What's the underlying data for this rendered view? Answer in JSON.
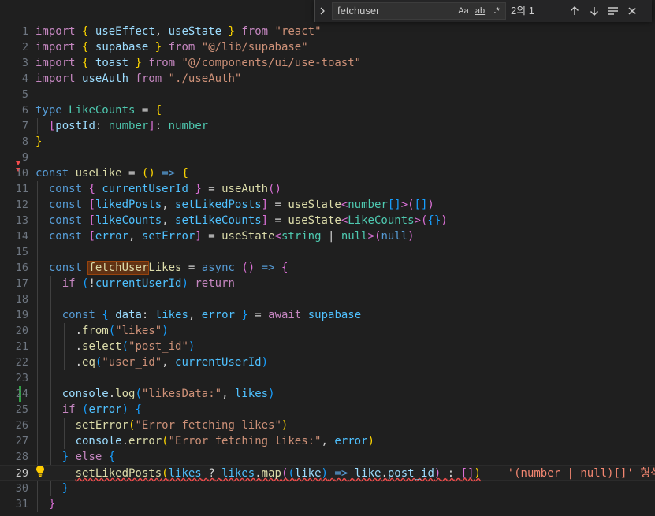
{
  "find": {
    "query": "fetchuser",
    "match_case_label": "Aa",
    "whole_word_label": "ab",
    "regex_label": ".*",
    "result_count": "2의 1"
  },
  "lines": [
    {
      "n": "1"
    },
    {
      "n": "2"
    },
    {
      "n": "3"
    },
    {
      "n": "4"
    },
    {
      "n": "5"
    },
    {
      "n": "6"
    },
    {
      "n": "7"
    },
    {
      "n": "8"
    },
    {
      "n": "9"
    },
    {
      "n": "10"
    },
    {
      "n": "11"
    },
    {
      "n": "12"
    },
    {
      "n": "13"
    },
    {
      "n": "14"
    },
    {
      "n": "15"
    },
    {
      "n": "16"
    },
    {
      "n": "17"
    },
    {
      "n": "18"
    },
    {
      "n": "19"
    },
    {
      "n": "20"
    },
    {
      "n": "21"
    },
    {
      "n": "22"
    },
    {
      "n": "23"
    },
    {
      "n": "24"
    },
    {
      "n": "25"
    },
    {
      "n": "26"
    },
    {
      "n": "27"
    },
    {
      "n": "28"
    },
    {
      "n": "29"
    },
    {
      "n": "30"
    },
    {
      "n": "31"
    }
  ],
  "tokens": {
    "import": "import",
    "from": "from",
    "useEffect": "useEffect",
    "useState": "useState",
    "react": "\"react\"",
    "supabase": "supabase",
    "lib_supabase": "\"@/lib/supabase\"",
    "toast": "toast",
    "use_toast": "\"@/components/ui/use-toast\"",
    "useAuth": "useAuth",
    "use_auth_path": "\"./useAuth\"",
    "type": "type",
    "LikeCounts": "LikeCounts",
    "postId": "postId",
    "number": "number",
    "const": "const",
    "useLike": "useLike",
    "currentUserId": "currentUserId",
    "likedPosts": "likedPosts",
    "setLikedPosts": "setLikedPosts",
    "likeCounts": "likeCounts",
    "setLikeCounts": "setLikeCounts",
    "error": "error",
    "setError": "setError",
    "string": "string",
    "null": "null",
    "fetchUser": "fetchUser",
    "Likes": "Likes",
    "async": "async",
    "if": "if",
    "return": "return",
    "data": "data",
    "likes": "likes",
    "await": "await",
    "from_fn": "from",
    "likes_str": "\"likes\"",
    "select": "select",
    "post_id_str": "\"post_id\"",
    "eq": "eq",
    "user_id_str": "\"user_id\"",
    "console": "console",
    "log": "log",
    "likesData_str": "\"likesData:\"",
    "err_fetch_str": "\"Error fetching likes\"",
    "err_fetch_colon_str": "\"Error fetching likes:\"",
    "else": "else",
    "map": "map",
    "like": "like",
    "post_id": "post_id",
    "inline_error": "'(number | null)[]' 형식의"
  }
}
